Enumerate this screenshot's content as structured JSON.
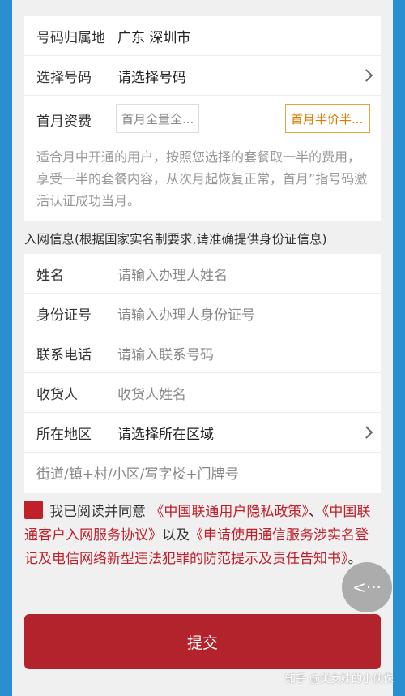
{
  "top_rows": [
    {
      "label": "号码归属地",
      "value": "广东 深圳市"
    },
    {
      "label": "选择号码",
      "value": "请选择号码"
    }
  ],
  "fee": {
    "label": "首月资费",
    "option1": "首月全量全...",
    "option2": "首月半价半...",
    "description": "适合月中开通的用户，按照您选择的套餐取一半的费用，享受一半的套餐内容，从次月起恢复正常，首月”指号码激活认证成功当月。"
  },
  "section_title": "入网信息(根据国家实名制要求,请准确提供身份证信息)",
  "form": {
    "name_label": "姓名",
    "name_placeholder": "请输入办理人姓名",
    "id_label": "身份证号",
    "id_placeholder": "请输入办理人身份证号",
    "phone_label": "联系电话",
    "phone_placeholder": "请输入联系号码",
    "receiver_label": "收货人",
    "receiver_placeholder": "收货人姓名",
    "region_label": "所在地区",
    "region_value": "请选择所在区域",
    "address_placeholder": "街道/镇+村/小区/写字楼+门牌号"
  },
  "agreement": {
    "prefix": "我已阅读并同意",
    "link1": "《中国联通用户隐私政策》",
    "sep1": "、",
    "link2": "《中国联通客户入网服务协议》",
    "sep2": "以及",
    "link3": "《申请使用通信服务涉实名登记及电信网络新型违法犯罪的防范提示及责任告知书》",
    "suffix": "。"
  },
  "submit_label": "提交",
  "float_button": "<···",
  "watermark": "知乎 @美女娃的小伙侏",
  "colors": {
    "accent": "#b3232b",
    "page_bg": "#2a8fcf",
    "fee_selected": "#e6a23c"
  }
}
